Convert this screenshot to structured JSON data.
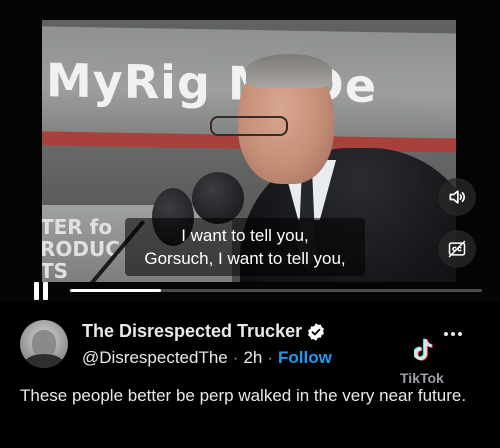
{
  "video": {
    "banner_text": "MyRig   MyDe",
    "banner_lower_text": "TER fo\nRODUC\nTS",
    "caption_lines": [
      "I want to tell you,",
      "Gorsuch, I want to tell you,"
    ],
    "progress_fraction": 0.22,
    "icons": {
      "volume": "speaker-icon",
      "captions": "closed-captions-icon",
      "pause": "pause-icon"
    }
  },
  "post": {
    "author": {
      "display_name": "The Disrespected Trucker",
      "handle": "@DisrespectedThe",
      "time": "2h",
      "follow_label": "Follow",
      "verified": true
    },
    "separator": "·",
    "watermark": "TikTok",
    "text": "These people better be perp walked in the very near future."
  },
  "colors": {
    "background": "#000000",
    "text": "#e7e9ea",
    "link": "#1d9bf0",
    "verified_badge": "#ffffff"
  }
}
